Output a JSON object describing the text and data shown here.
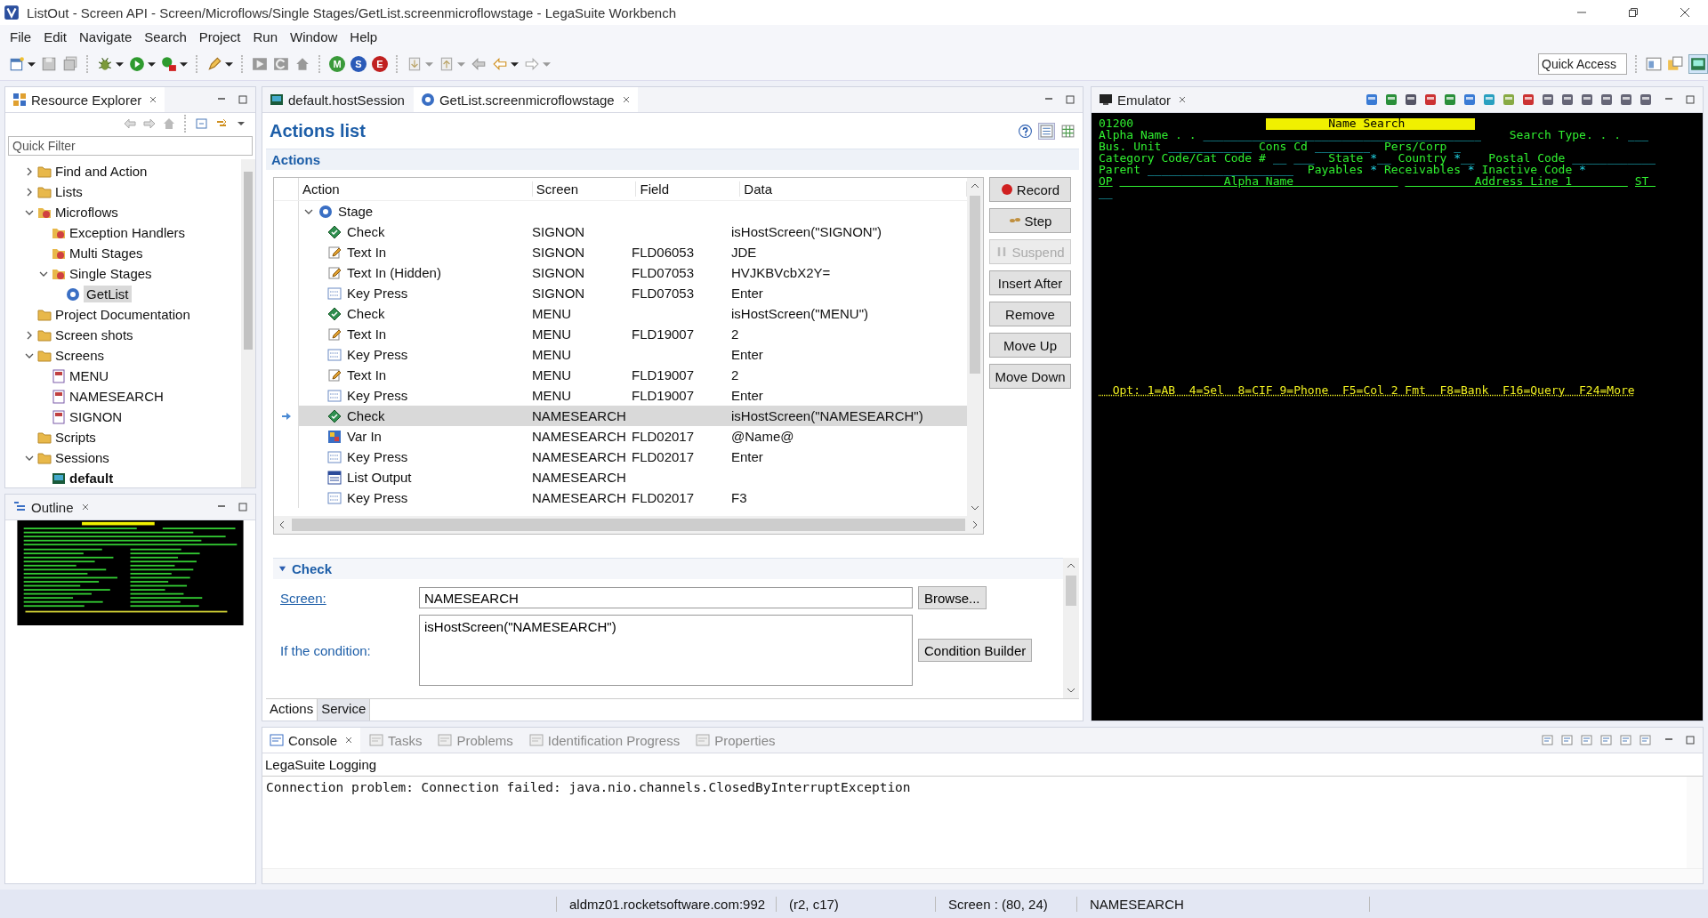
{
  "window": {
    "title": "ListOut - Screen API - Screen/Microflows/Single Stages/GetList.screenmicroflowstage - LegaSuite Workbench"
  },
  "menu": [
    "File",
    "Edit",
    "Navigate",
    "Search",
    "Project",
    "Run",
    "Window",
    "Help"
  ],
  "toolbar": {
    "letter_buttons": [
      "M",
      "S",
      "E"
    ],
    "quick_access": {
      "placeholder": "Quick Access"
    }
  },
  "explorer": {
    "title": "Resource Explorer",
    "filter": {
      "placeholder": "Quick Filter"
    },
    "items": [
      {
        "label": "Find and Action",
        "kind": "folder",
        "expanded": false,
        "selected": false
      },
      {
        "label": "Lists",
        "kind": "folder",
        "expanded": false,
        "selected": false
      },
      {
        "label": "Microflows",
        "kind": "flow",
        "expanded": true,
        "selected": false,
        "children": [
          {
            "label": "Exception Handlers",
            "kind": "flow",
            "selected": false
          },
          {
            "label": "Multi Stages",
            "kind": "flow",
            "selected": false
          },
          {
            "label": "Single Stages",
            "kind": "flow",
            "expanded": true,
            "selected": false,
            "children": [
              {
                "label": "GetList",
                "kind": "stage",
                "selected": true
              }
            ]
          }
        ]
      },
      {
        "label": "Project Documentation",
        "kind": "folder",
        "selected": false
      },
      {
        "label": "Screen shots",
        "kind": "folder",
        "expanded": false,
        "selected": false
      },
      {
        "label": "Screens",
        "kind": "folder",
        "expanded": true,
        "selected": false,
        "children": [
          {
            "label": "MENU",
            "kind": "screen",
            "selected": false
          },
          {
            "label": "NAMESEARCH",
            "kind": "screen",
            "selected": false
          },
          {
            "label": "SIGNON",
            "kind": "screen",
            "selected": false
          }
        ]
      },
      {
        "label": "Scripts",
        "kind": "folder",
        "selected": false
      },
      {
        "label": "Sessions",
        "kind": "folder",
        "expanded": true,
        "selected": false,
        "children": [
          {
            "label": "default",
            "kind": "session",
            "selected": false
          }
        ]
      }
    ]
  },
  "outline": {
    "title": "Outline"
  },
  "editor": {
    "tabs": [
      {
        "label": "default.hostSession",
        "kind": "session",
        "selected": false
      },
      {
        "label": "GetList.screenmicroflowstage",
        "kind": "stage",
        "selected": true
      }
    ],
    "heading": "Actions list",
    "section": "Actions",
    "columns": [
      "Action",
      "Screen",
      "Field",
      "Data"
    ],
    "rows": [
      {
        "action": "Stage",
        "kind": "stage",
        "expanded": true,
        "selected": false,
        "current": false,
        "children": [
          {
            "action": "Check",
            "kind": "check",
            "screen": "SIGNON",
            "data": "isHostScreen(\"SIGNON\")",
            "selected": false,
            "current": false
          },
          {
            "action": "Text In",
            "kind": "text-in",
            "screen": "SIGNON",
            "field": "FLD06053",
            "data": "JDE",
            "selected": false,
            "current": false
          },
          {
            "action": "Text In (Hidden)",
            "kind": "text-in",
            "screen": "SIGNON",
            "field": "FLD07053",
            "data": "HVJKBVcbX2Y=",
            "selected": false,
            "current": false
          },
          {
            "action": "Key Press",
            "kind": "key-press",
            "screen": "SIGNON",
            "field": "FLD07053",
            "data": "Enter",
            "selected": false,
            "current": false
          },
          {
            "action": "Check",
            "kind": "check",
            "screen": "MENU",
            "data": "isHostScreen(\"MENU\")",
            "selected": false,
            "current": false
          },
          {
            "action": "Text In",
            "kind": "text-in",
            "screen": "MENU",
            "field": "FLD19007",
            "data": "2",
            "selected": false,
            "current": false
          },
          {
            "action": "Key Press",
            "kind": "key-press",
            "screen": "MENU",
            "data": "Enter",
            "selected": false,
            "current": false
          },
          {
            "action": "Text In",
            "kind": "text-in",
            "screen": "MENU",
            "field": "FLD19007",
            "data": "2",
            "selected": false,
            "current": false
          },
          {
            "action": "Key Press",
            "kind": "key-press",
            "screen": "MENU",
            "field": "FLD19007",
            "data": "Enter",
            "selected": false,
            "current": false
          },
          {
            "action": "Check",
            "kind": "check",
            "screen": "NAMESEARCH",
            "data": "isHostScreen(\"NAMESEARCH\")",
            "selected": true,
            "current": true
          },
          {
            "action": "Var In",
            "kind": "var-in",
            "screen": "NAMESEARCH",
            "field": "FLD02017",
            "data": "@Name@",
            "selected": false,
            "current": false
          },
          {
            "action": "Key Press",
            "kind": "key-press",
            "screen": "NAMESEARCH",
            "field": "FLD02017",
            "data": "Enter",
            "selected": false,
            "current": false
          },
          {
            "action": "List Output",
            "kind": "list-output",
            "screen": "NAMESEARCH",
            "selected": false,
            "current": false
          },
          {
            "action": "Key Press",
            "kind": "key-press",
            "screen": "NAMESEARCH",
            "field": "FLD02017",
            "data": "F3",
            "selected": false,
            "current": false
          }
        ]
      }
    ],
    "buttons": [
      {
        "label": "Record",
        "kind": "record",
        "disabled": false
      },
      {
        "label": "Step",
        "kind": "step",
        "disabled": false
      },
      {
        "label": "Suspend",
        "kind": "suspend",
        "disabled": true
      },
      {
        "label": "Insert After",
        "kind": "plain",
        "disabled": false
      },
      {
        "label": "Remove",
        "kind": "plain",
        "disabled": false
      },
      {
        "label": "Move Up",
        "kind": "plain",
        "disabled": false
      },
      {
        "label": "Move Down",
        "kind": "plain",
        "disabled": false
      }
    ],
    "check": {
      "title": "Check",
      "expanded": true,
      "screen_link": "Screen:",
      "screen_value": "NAMESEARCH",
      "browse": "Browse...",
      "condition_label": "If the condition:",
      "condition": "isHostScreen(\"NAMESEARCH\")",
      "builder": "Condition Builder"
    },
    "bottom_tabs": [
      {
        "label": "Actions",
        "selected": true
      },
      {
        "label": "Service",
        "selected": false
      }
    ]
  },
  "emulator": {
    "title": "Emulator",
    "lines": [
      {
        "segments": [
          {
            "kind": "text",
            "text": "01200                   "
          },
          {
            "kind": "title",
            "text": "         Name Search          "
          }
        ]
      },
      {
        "segments": [
          {
            "kind": "text",
            "text": "Alpha Name . . "
          },
          {
            "kind": "field",
            "text": "________________________________________"
          },
          {
            "kind": "text",
            "text": "    Search Type. . . "
          },
          {
            "kind": "field",
            "text": "___"
          }
        ]
      },
      {
        "segments": [
          {
            "kind": "text",
            "text": "Bus. Unit "
          },
          {
            "kind": "field",
            "text": "____________"
          },
          {
            "kind": "text",
            "text": " Cons Cd "
          },
          {
            "kind": "field",
            "text": "________"
          },
          {
            "kind": "text",
            "text": "  Pers/Corp "
          },
          {
            "kind": "field",
            "text": "_"
          }
        ]
      },
      {
        "segments": [
          {
            "kind": "text",
            "text": "Category Code/Cat Code # "
          },
          {
            "kind": "field",
            "text": "__ ___"
          },
          {
            "kind": "text",
            "text": "  State "
          },
          {
            "kind": "field",
            "text": "*__"
          },
          {
            "kind": "text",
            "text": " Country "
          },
          {
            "kind": "field",
            "text": "*__"
          },
          {
            "kind": "text",
            "text": "  Postal Code "
          },
          {
            "kind": "field",
            "text": "____________"
          }
        ]
      },
      {
        "segments": [
          {
            "kind": "text",
            "text": "Parent "
          },
          {
            "kind": "field",
            "text": "_____________________"
          },
          {
            "kind": "text",
            "text": "  Payables "
          },
          {
            "kind": "field",
            "text": "*"
          },
          {
            "kind": "text",
            "text": " Receivables "
          },
          {
            "kind": "field",
            "text": "*"
          },
          {
            "kind": "text",
            "text": " Inactive Code "
          },
          {
            "kind": "field",
            "text": "*"
          }
        ]
      },
      {
        "segments": [
          {
            "kind": "header",
            "text": "OP"
          },
          {
            "kind": "header",
            "text": "               Alpha Name               "
          },
          {
            "kind": "header",
            "text": "          Address Line 1        "
          },
          {
            "kind": "header",
            "text": "ST "
          }
        ]
      },
      {
        "segments": [
          {
            "kind": "field",
            "text": "__"
          }
        ]
      }
    ],
    "function_keys": "  Opt: 1=AB  4=Sel  8=CIF 9=Phone  F5=Col 2 Fmt  F8=Bank  F16=Query  F24=More"
  },
  "console": {
    "tabs": [
      {
        "label": "Console",
        "selected": true
      },
      {
        "label": "Tasks",
        "selected": false
      },
      {
        "label": "Problems",
        "selected": false
      },
      {
        "label": "Identification Progress",
        "selected": false
      },
      {
        "label": "Properties",
        "selected": false
      }
    ],
    "heading": "LegaSuite Logging",
    "lines": [
      "Connection problem: Connection failed: java.nio.channels.ClosedByInterruptException"
    ]
  },
  "status_bar": [
    "aldmz01.rocketsoftware.com:992",
    "(r2, c17)",
    "Screen : (80, 24)",
    "NAMESEARCH"
  ]
}
